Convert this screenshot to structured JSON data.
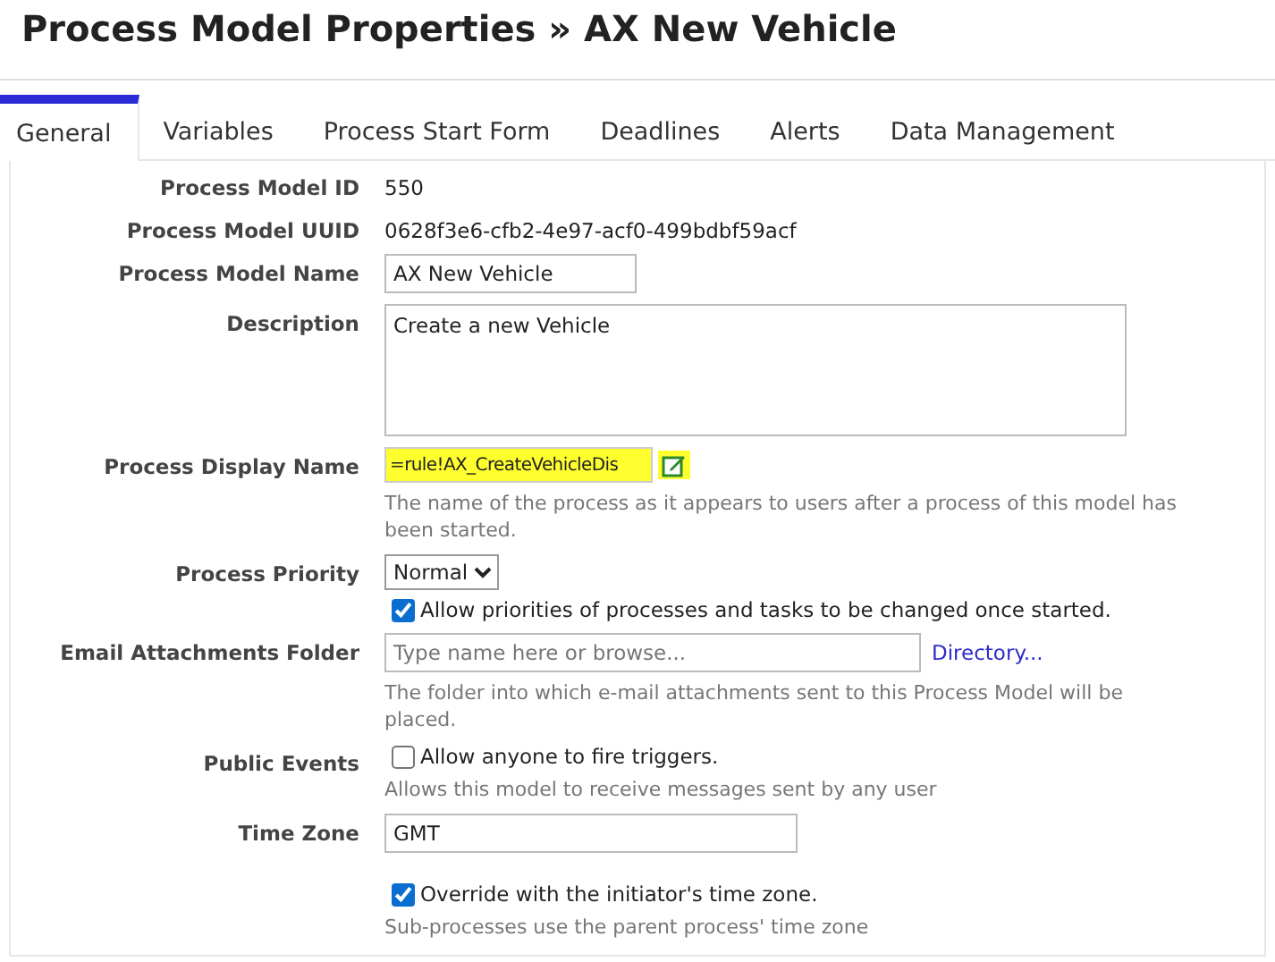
{
  "title": "Process Model Properties » AX New Vehicle",
  "tabs": [
    {
      "label": "General",
      "selected": true
    },
    {
      "label": "Variables",
      "selected": false
    },
    {
      "label": "Process Start Form",
      "selected": false
    },
    {
      "label": "Deadlines",
      "selected": false
    },
    {
      "label": "Alerts",
      "selected": false
    },
    {
      "label": "Data Management",
      "selected": false
    }
  ],
  "fields": [
    {
      "label": "Process Model ID",
      "items": [
        {
          "kind": "text",
          "text": "550"
        }
      ]
    },
    {
      "label": "Process Model UUID",
      "items": [
        {
          "kind": "text",
          "text": "0628f3e6-cfb2-4e97-acf0-499bdbf59acf"
        }
      ]
    },
    {
      "label": "Process Model Name",
      "items": [
        {
          "kind": "short-input",
          "value": "AX New Vehicle"
        }
      ]
    },
    {
      "label": "Description",
      "items": [
        {
          "kind": "textarea",
          "value": "Create a new Vehicle"
        }
      ]
    },
    {
      "label": "Process Display Name",
      "items": [
        {
          "kind": "expression",
          "value": "=rule!AX_CreateVehicleDis"
        },
        {
          "kind": "hint",
          "text": "The name of the process as it appears to users after a process of this model has been started."
        }
      ]
    },
    {
      "label": "Process Priority",
      "items": [
        {
          "kind": "select",
          "value": "Normal"
        },
        {
          "kind": "checkbox",
          "text": "Allow priorities of processes and tasks to be changed once started.",
          "checked": true
        }
      ]
    },
    {
      "label": "Email Attachments Folder",
      "items": [
        {
          "kind": "browse",
          "placeholder": "Type name here or browse...",
          "link": "Directory..."
        },
        {
          "kind": "hint",
          "text": "The folder into which e-mail attachments sent to this Process Model will be placed."
        }
      ]
    },
    {
      "label": "Public Events",
      "items": [
        {
          "kind": "checkbox",
          "text": "Allow anyone to fire triggers.",
          "checked": false
        },
        {
          "kind": "hint",
          "text": "Allows this model to receive messages sent by any user"
        }
      ]
    },
    {
      "label": "Time Zone",
      "items": [
        {
          "kind": "medium-input",
          "value": "GMT"
        },
        {
          "kind": "checkbox",
          "text": "Override with the initiator's time zone.",
          "checked": true
        },
        {
          "kind": "hint",
          "text": "Sub-processes use the parent process' time zone"
        }
      ]
    }
  ]
}
